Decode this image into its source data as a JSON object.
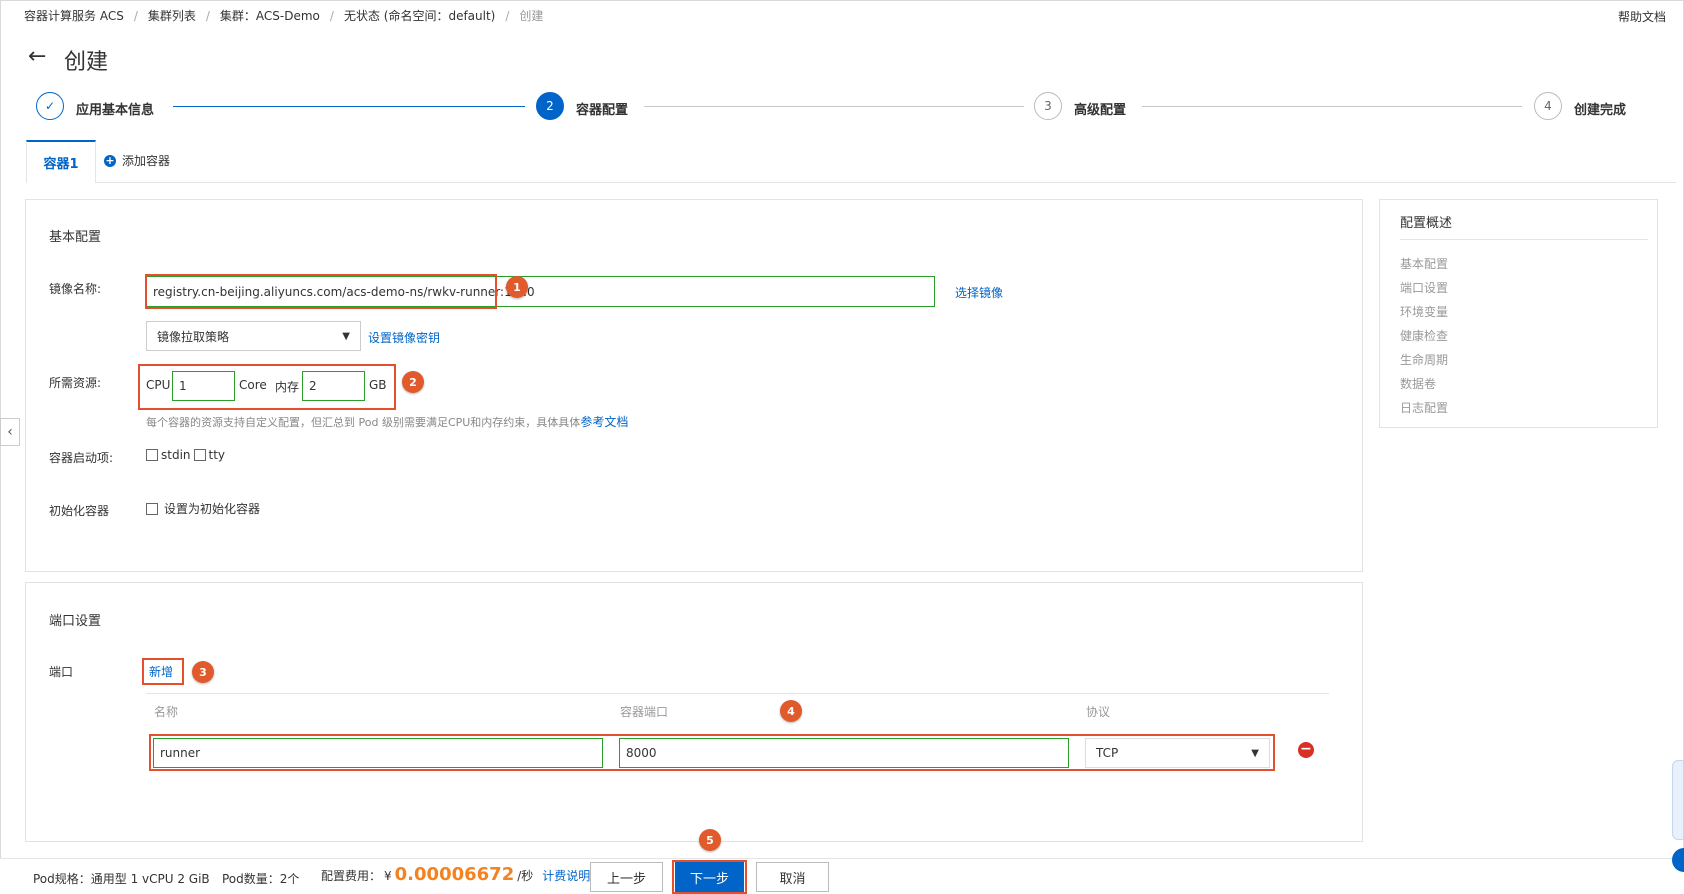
{
  "breadcrumb": {
    "items": [
      "容器计算服务 ACS",
      "集群列表",
      "集群：ACS-Demo",
      "无状态 (命名空间：default)",
      "创建"
    ],
    "separator": "/"
  },
  "help_link": "帮助文档",
  "page": {
    "back_icon": "←",
    "title": "创建"
  },
  "steps": {
    "items": [
      {
        "number": "✓",
        "label": "应用基本信息",
        "state": "done"
      },
      {
        "number": "2",
        "label": "容器配置",
        "state": "active"
      },
      {
        "number": "3",
        "label": "高级配置",
        "state": "pending"
      },
      {
        "number": "4",
        "label": "创建完成",
        "state": "pending"
      }
    ]
  },
  "tabs": {
    "active": "容器1",
    "add_label": "添加容器",
    "add_icon": "+"
  },
  "basic": {
    "title": "基本配置",
    "image_label": "镜像名称:",
    "image_value": "registry.cn-beijing.aliyuncs.com/acs-demo-ns/rwkv-runner:1.0.0",
    "select_image": "选择镜像",
    "pull_policy_placeholder": "镜像拉取策略",
    "set_secret": "设置镜像密钥",
    "resource_label": "所需资源:",
    "cpu_label": "CPU",
    "cpu_value": "1",
    "cpu_unit": "Core",
    "mem_label": "内存",
    "mem_value": "2",
    "mem_unit": "GB",
    "resource_hint": "每个容器的资源支持自定义配置，但汇总到 Pod 级别需要满足CPU和内存约束，具体具体",
    "resource_hint_link": "参考文档",
    "startup_label": "容器启动项:",
    "stdin_label": "stdin",
    "tty_label": "tty",
    "init_label": "初始化容器",
    "init_checkbox_label": "设置为初始化容器"
  },
  "ports": {
    "title": "端口设置",
    "label": "端口",
    "add_link": "新增",
    "columns": [
      "名称",
      "容器端口",
      "协议"
    ],
    "rows": [
      {
        "name": "runner",
        "port": "8000",
        "protocol": "TCP"
      }
    ],
    "remove_icon": "−"
  },
  "overview": {
    "title": "配置概述",
    "items": [
      "基本配置",
      "端口设置",
      "环境变量",
      "健康检查",
      "生命周期",
      "数据卷",
      "日志配置"
    ]
  },
  "badges": [
    "1",
    "2",
    "3",
    "4",
    "5"
  ],
  "footer": {
    "pod_spec": "Pod规格：通用型 1 vCPU 2 GiB",
    "pod_count": "Pod数量：2个",
    "cost_label": "配置费用：",
    "currency": "¥",
    "cost_value": "0.00006672",
    "cost_unit": "/秒",
    "cost_link": "计费说明",
    "prev": "上一步",
    "next": "下一步",
    "cancel": "取消"
  },
  "side_collapse_icon": "‹",
  "colors": {
    "primary": "#0064c8",
    "badge": "#e05a2b",
    "price": "#f58220",
    "input_border": "#2a9d2a"
  }
}
